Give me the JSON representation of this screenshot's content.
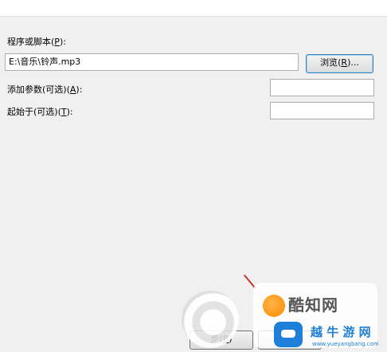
{
  "dialog": {
    "program": {
      "label": "程序或脚本(",
      "hotkey": "P",
      "suffix": "):",
      "value": "E:\\音乐\\铃声.mp3"
    },
    "browse": {
      "label": "浏览(",
      "hotkey": "R",
      "suffix": ")..."
    },
    "arguments": {
      "label": "添加参数(可选)(",
      "hotkey": "A",
      "suffix": "):",
      "value": ""
    },
    "start_in": {
      "label": "起始于(可选)(",
      "hotkey": "T",
      "suffix": "):",
      "value": ""
    },
    "back_button": {
      "text": "步(",
      "hotkey": "B",
      "suffix": ")"
    }
  },
  "watermark": {
    "site_name": "酷知网",
    "secondary_name": "越 牛 游 网",
    "url": "www.yueyangbang.com"
  }
}
